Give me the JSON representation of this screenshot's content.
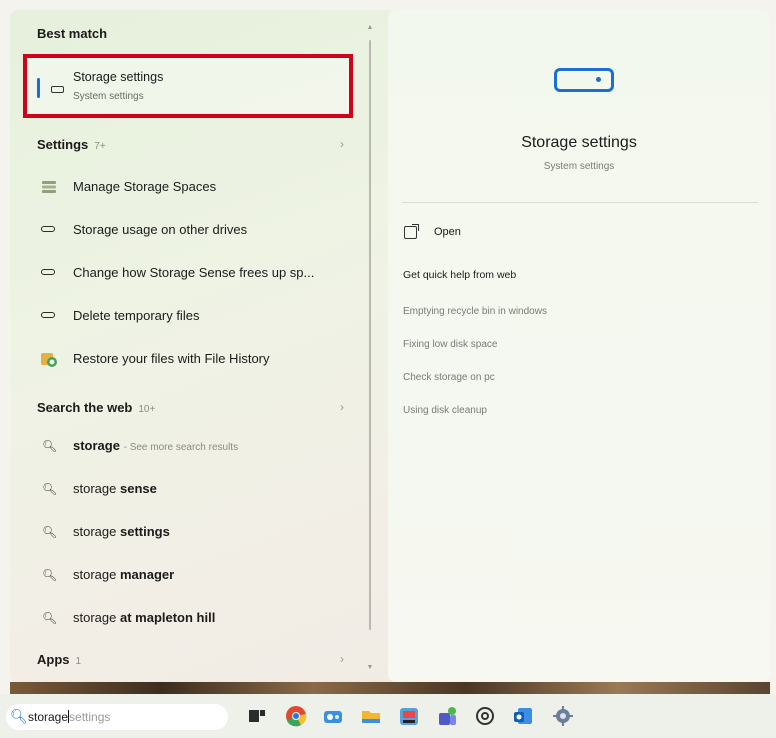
{
  "best_match": {
    "heading": "Best match",
    "title": "Storage settings",
    "subtitle": "System settings"
  },
  "settings_section": {
    "heading": "Settings",
    "count": "7+",
    "items": [
      {
        "label": "Manage Storage Spaces",
        "icon": "storage-spaces-icon"
      },
      {
        "label": "Storage usage on other drives",
        "icon": "drive-icon"
      },
      {
        "label": "Change how Storage Sense frees up sp...",
        "icon": "drive-icon"
      },
      {
        "label": "Delete temporary files",
        "icon": "drive-icon"
      },
      {
        "label": "Restore your files with File History",
        "icon": "file-history-icon"
      }
    ]
  },
  "web_section": {
    "heading": "Search the web",
    "count": "10+",
    "items": [
      {
        "query": "storage",
        "bold": "",
        "hint": "- See more search results"
      },
      {
        "query": "storage ",
        "bold": "sense",
        "hint": ""
      },
      {
        "query": "storage ",
        "bold": "settings",
        "hint": ""
      },
      {
        "query": "storage ",
        "bold": "manager",
        "hint": ""
      },
      {
        "query": "storage ",
        "bold": "at mapleton hill",
        "hint": ""
      }
    ]
  },
  "apps_section": {
    "heading": "Apps",
    "count": "1"
  },
  "detail": {
    "title": "Storage settings",
    "subtitle": "System settings",
    "open_label": "Open",
    "quick_help": "Get quick help from web",
    "links": [
      "Emptying recycle bin in windows",
      "Fixing low disk space",
      "Check storage on pc",
      "Using disk cleanup"
    ]
  },
  "taskbar": {
    "search_typed": "storage",
    "search_suggestion": "settings"
  },
  "colors": {
    "accent": "#1a6fd1",
    "highlight_box": "#d0021b"
  }
}
